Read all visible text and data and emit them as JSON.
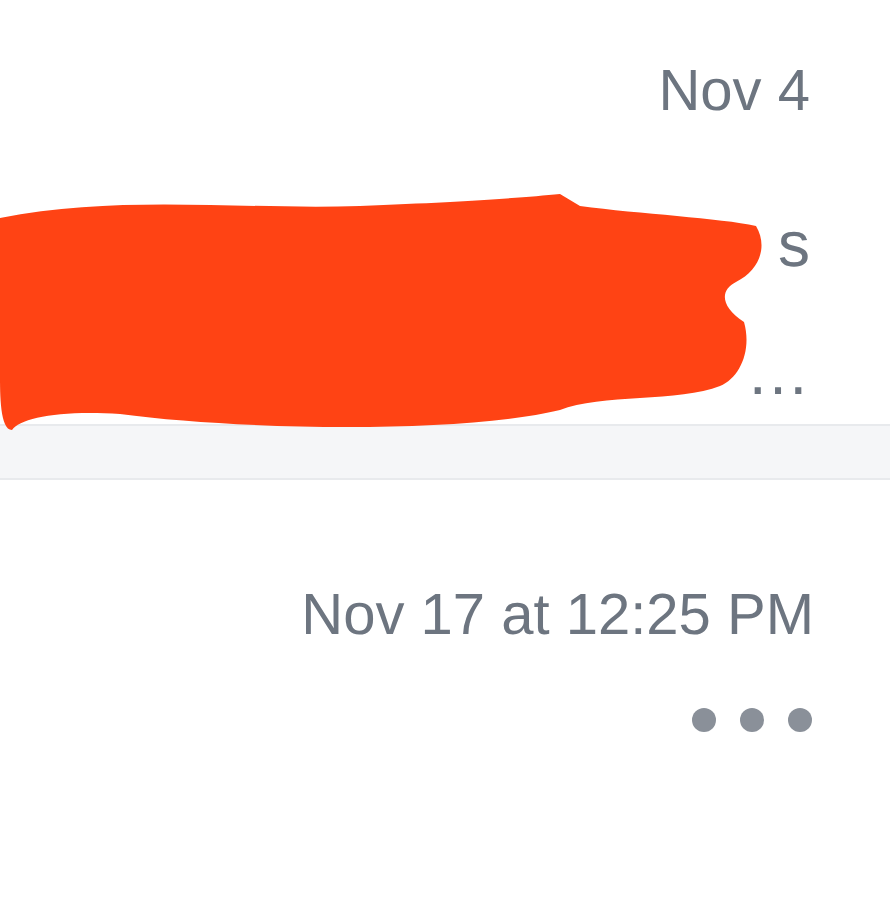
{
  "messages": [
    {
      "date": "Nov 4",
      "preview_lines": [
        "s",
        "…"
      ],
      "redacted": true
    },
    {
      "date": "Nov 17 at 12:25 PM",
      "more_button": true
    }
  ]
}
